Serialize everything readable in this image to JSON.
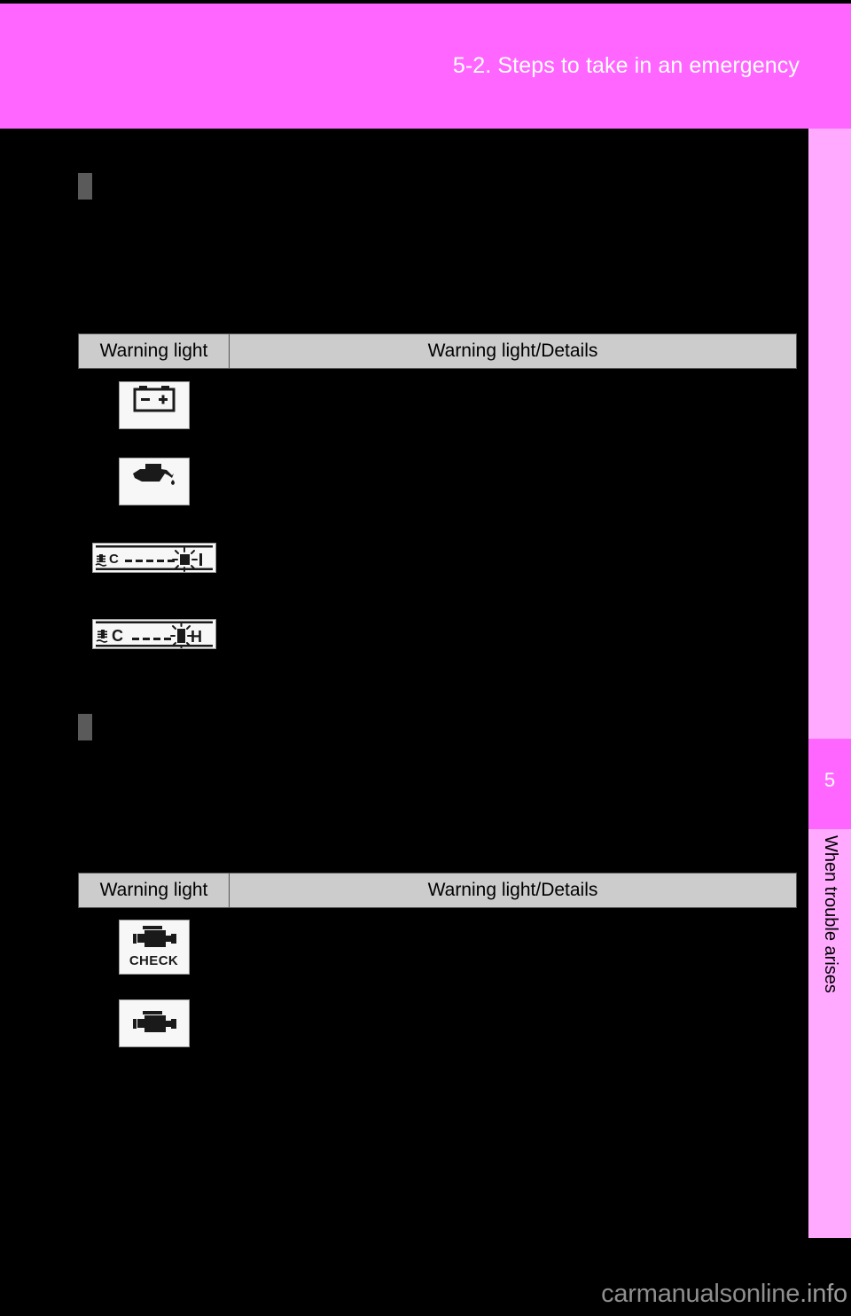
{
  "header": {
    "title": "5-2. Steps to take in an emergency",
    "band_color": "#ff66ff"
  },
  "side_tab": {
    "chapter_number": "5",
    "chapter_label": "When trouble arises",
    "strip_color": "#ffaaff",
    "block_color": "#ff66ff"
  },
  "sections": [
    {
      "marker": "section-marker",
      "table": {
        "columns": [
          "Warning light",
          "Warning light/Details"
        ],
        "rows": [
          {
            "icon": "battery-warning-icon",
            "details": ""
          },
          {
            "icon": "oil-pressure-warning-icon",
            "details": ""
          },
          {
            "icon": "coolant-temp-gauge-low-icon",
            "details": ""
          },
          {
            "icon": "coolant-temp-gauge-high-icon",
            "details": ""
          }
        ]
      }
    },
    {
      "marker": "section-marker",
      "table": {
        "columns": [
          "Warning light",
          "Warning light/Details"
        ],
        "rows": [
          {
            "icon": "check-engine-text-icon",
            "icon_text": "CHECK",
            "details": ""
          },
          {
            "icon": "check-engine-icon",
            "details": ""
          }
        ]
      }
    }
  ],
  "watermark": {
    "text_main": "carmanualsonline",
    "text_suffix": ".info",
    "color": "#8e8e8e"
  }
}
